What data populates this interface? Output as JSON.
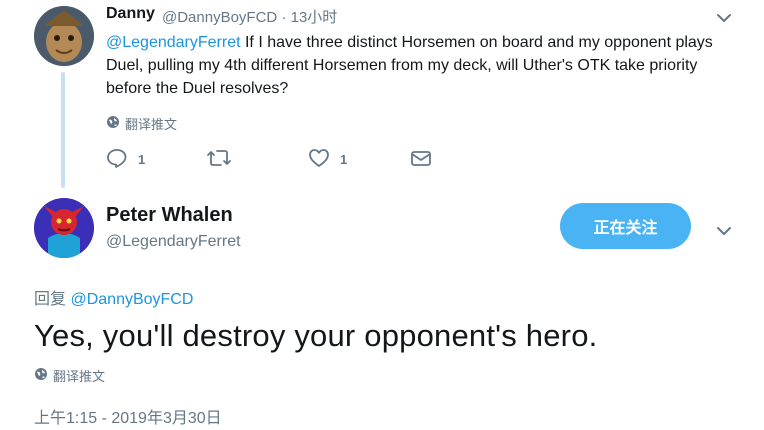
{
  "reply_tweet": {
    "author_name": "Danny",
    "author_handle": "@DannyBoyFCD",
    "time_separator": "·",
    "time": "13小时",
    "mention": "@LegendaryFerret",
    "text": " If I have three distinct Horsemen on board and my opponent plays Duel, pulling my 4th different Horsemen from my deck, will Uther's OTK take priority before the Duel resolves?",
    "translate_label": "翻译推文",
    "reply_count": "1",
    "like_count": "1"
  },
  "main_tweet": {
    "author_name": "Peter Whalen",
    "author_handle": "@LegendaryFerret",
    "follow_button": "正在关注",
    "replying_prefix": "回复",
    "replying_to": "@DannyBoyFCD",
    "text": "Yes, you'll destroy your opponent's hero.",
    "translate_label": "翻译推文",
    "timestamp": "上午1:15 - 2019年3月30日"
  },
  "colors": {
    "link": "#1b95e0",
    "follow_button_bg": "#4ab3f4",
    "secondary_text": "#657786",
    "thread_line": "#c4dff6"
  }
}
